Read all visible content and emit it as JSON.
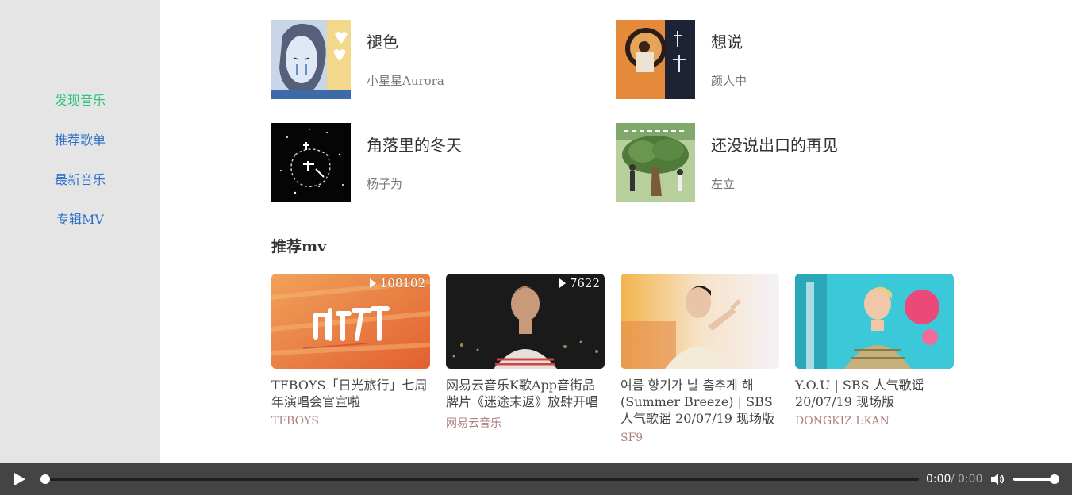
{
  "sidebar": {
    "items": [
      {
        "label": "发现音乐",
        "active": true
      },
      {
        "label": "推荐歌单",
        "active": false
      },
      {
        "label": "最新音乐",
        "active": false
      },
      {
        "label": "专辑MV",
        "active": false
      }
    ]
  },
  "songs": [
    {
      "title": "褪色",
      "artist": "小星星Aurora"
    },
    {
      "title": "想说",
      "artist": "颜人中"
    },
    {
      "title": "角落里的冬天",
      "artist": "杨子为"
    },
    {
      "title": "还没说出口的再见",
      "artist": "左立"
    }
  ],
  "mv_section": {
    "title": "推荐mv",
    "items": [
      {
        "title": "TFBOYS「日光旅行」七周年演唱会官宣啦",
        "artist": "TFBOYS",
        "play_count": "108102"
      },
      {
        "title": "网易云音乐K歌App音街品牌片《迷途末返》放肆开唱",
        "artist": "网易云音乐",
        "play_count": "7622"
      },
      {
        "title": "여름 향기가 날 춤추게 해 (Summer Breeze) | SBS 人气歌谣 20/07/19 现场版",
        "artist": "SF9",
        "play_count": ""
      },
      {
        "title": "Y.O.U | SBS 人气歌谣 20/07/19 现场版",
        "artist": "DONGKIZ I:KAN",
        "play_count": ""
      }
    ]
  },
  "player": {
    "current_time": "0:00",
    "separator": "/",
    "duration": "0:00",
    "progress": 0,
    "volume": 1.0
  },
  "colors": {
    "sidebar_bg": "#e5e5e5",
    "nav_link": "#2b6fc9",
    "nav_active": "#31c27c",
    "player_bg": "#444444"
  },
  "icons": {
    "play": "play-icon",
    "volume": "volume-icon",
    "mv_play": "play-triangle-icon"
  }
}
